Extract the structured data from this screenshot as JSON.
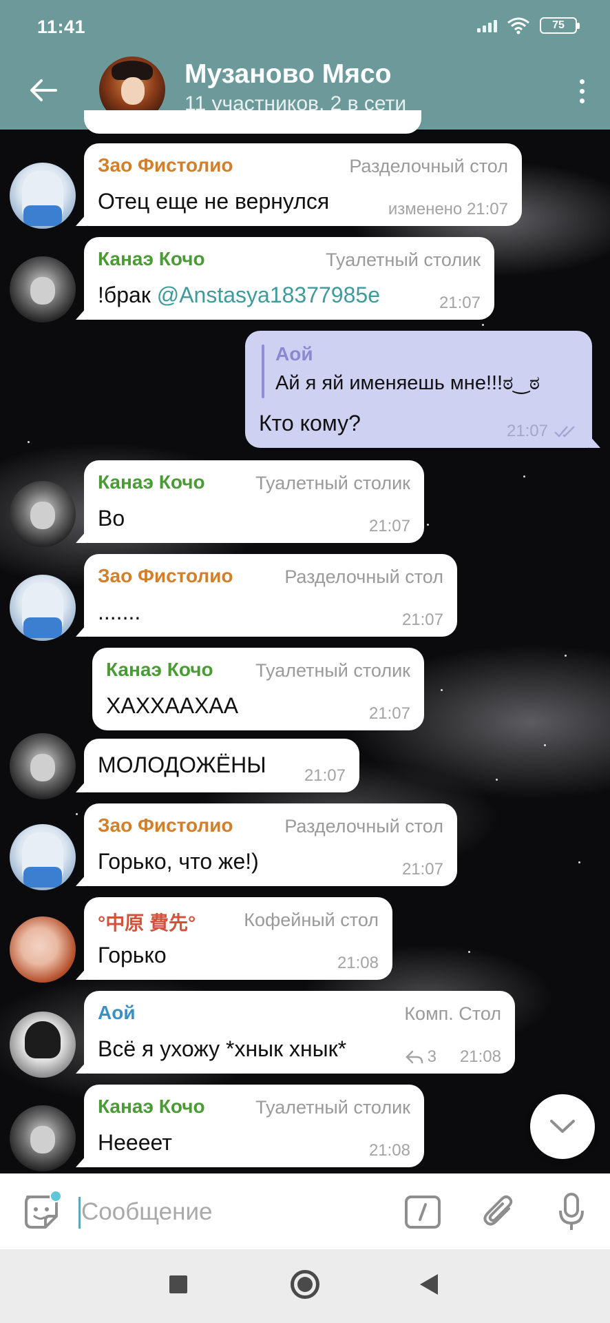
{
  "status_bar": {
    "time": "11:41",
    "battery": "75"
  },
  "header": {
    "title": "Музаново Мясо",
    "subtitle": "11 участников, 2 в сети"
  },
  "messages": [
    {
      "sender": "Зао Фистолио",
      "title": "Разделочный стол",
      "text": "Отец еще не вернулся",
      "time": "изменено 21:07"
    },
    {
      "sender": "Канаэ Кочо",
      "title": "Туалетный столик",
      "text": "!брак ",
      "mention": "@Anstasya18377985e",
      "time": "21:07"
    },
    {
      "reply_to": "Аой",
      "reply_text": "Ай я яй именяешь мне!!!ಠ‿ಠ",
      "text": "Кто кому?",
      "time": "21:07"
    },
    {
      "sender": "Канаэ Кочо",
      "title": "Туалетный столик",
      "text": "Во",
      "time": "21:07"
    },
    {
      "sender": "Зао Фистолио",
      "title": "Разделочный стол",
      "text": ".......",
      "time": "21:07"
    },
    {
      "sender": "Канаэ Кочо",
      "title": "Туалетный столик",
      "text": "ХАХХААХАА",
      "time": "21:07"
    },
    {
      "text": "МОЛОДОЖЁНЫ",
      "time": "21:07"
    },
    {
      "sender": "Зао Фистолио",
      "title": "Разделочный стол",
      "text": "Горько, что же!)",
      "time": "21:07"
    },
    {
      "sender": "°中原 費先°",
      "title": "Кофейный стол",
      "text": "Горько",
      "time": "21:08"
    },
    {
      "sender": "Аой",
      "title": "Комп. Стол",
      "text": "Всё я ухожу *хнык хнык*",
      "replies": "3",
      "time": "21:08"
    },
    {
      "sender": "Канаэ Кочо",
      "title": "Туалетный столик",
      "text": "Неееет",
      "time": "21:08"
    }
  ],
  "input": {
    "placeholder": "Сообщение"
  },
  "colors": {
    "header": "#6c9a9a",
    "outgoing_bubble": "#cfd1f3",
    "incoming_bubble": "#ffffff",
    "name_zao": "#d27f2c",
    "name_kanae": "#4a9b36",
    "name_nakahara": "#d0533d",
    "name_aoi": "#3b8fc4"
  }
}
